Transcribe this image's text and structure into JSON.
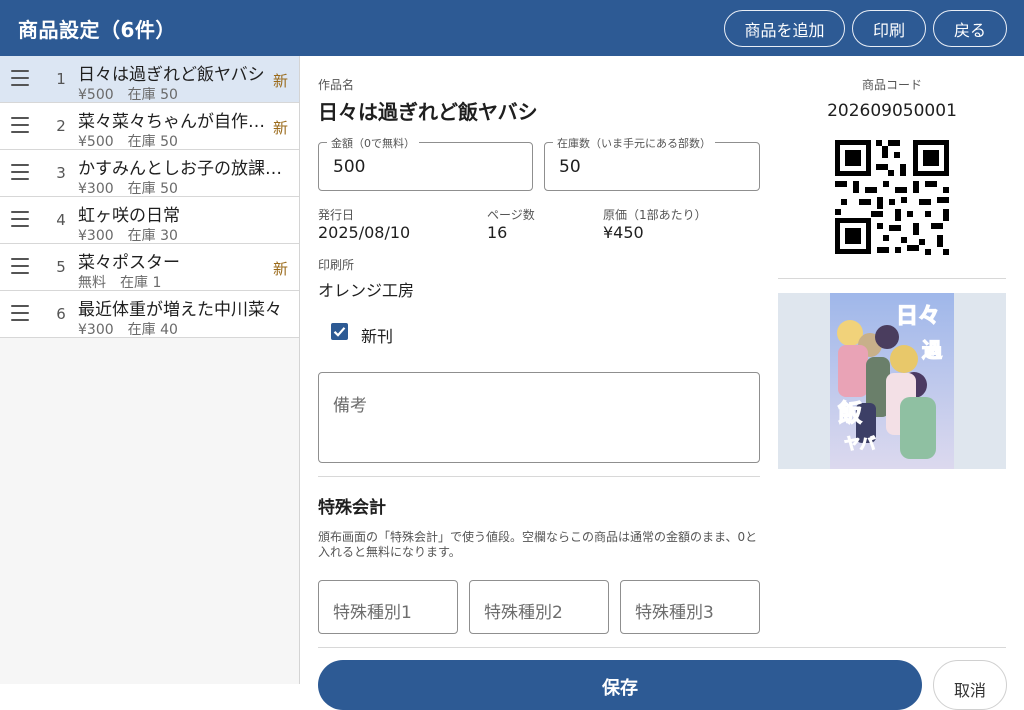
{
  "header": {
    "title": "商品設定（6件）",
    "add_label": "商品を追加",
    "print_label": "印刷",
    "back_label": "戻る"
  },
  "sidebar": {
    "items": [
      {
        "num": "1",
        "name": "日々は過ぎれど飯ヤバシ",
        "meta": "¥500　在庫 50",
        "badge": "新"
      },
      {
        "num": "2",
        "name": "菜々菜々ちゃんが自作…",
        "meta": "¥500　在庫 50",
        "badge": "新"
      },
      {
        "num": "3",
        "name": "かすみんとしお子の放課…",
        "meta": "¥300　在庫 50",
        "badge": ""
      },
      {
        "num": "4",
        "name": "虹ヶ咲の日常",
        "meta": "¥300　在庫 30",
        "badge": ""
      },
      {
        "num": "5",
        "name": "菜々ポスター",
        "meta": "無料　在庫 1",
        "badge": "新"
      },
      {
        "num": "6",
        "name": "最近体重が増えた中川菜々",
        "meta": "¥300　在庫 40",
        "badge": ""
      }
    ]
  },
  "detail": {
    "work_label": "作品名",
    "work_title": "日々は過ぎれど飯ヤバシ",
    "price_label": "金額（0で無料）",
    "price_value": "500",
    "stock_label": "在庫数（いま手元にある部数）",
    "stock_value": "50",
    "date_label": "発行日",
    "date_value": "2025/08/10",
    "pages_label": "ページ数",
    "pages_value": "16",
    "cost_label": "原価（1部あたり）",
    "cost_value": "¥450",
    "printer_label": "印刷所",
    "printer_value": "オレンジ工房",
    "new_checkbox_label": "新刊",
    "new_checked": true,
    "notes_placeholder": "備考",
    "special_heading": "特殊会計",
    "special_desc": "頒布画面の「特殊会計」で使う値段。空欄ならこの商品は通常の金額のまま、0と入れると無料になります。",
    "special1_placeholder": "特殊種別1",
    "special2_placeholder": "特殊種別2",
    "special3_placeholder": "特殊種別3",
    "save_label": "保存",
    "cancel_label": "取消"
  },
  "code": {
    "label": "商品コード",
    "value": "202609050001"
  },
  "colors": {
    "accent": "#2d5a94",
    "selected_row": "#dce6f3",
    "new_badge": "#9a6a1a"
  }
}
